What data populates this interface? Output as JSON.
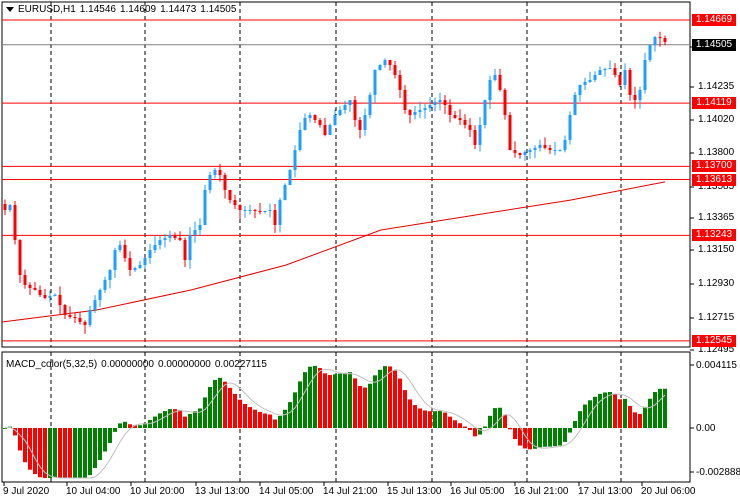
{
  "header": {
    "symbol": "EURUSD,H1",
    "open": "1.14546",
    "high": "1.14609",
    "low": "1.14473",
    "close": "1.14505"
  },
  "macd_header": {
    "label": "MACD_color(5,32,5)",
    "v1": "0.00000000",
    "v2": "0.00000000",
    "v3": "0.00227115"
  },
  "colors": {
    "bull": "#1E9FFF",
    "bear": "#FF0000",
    "macd_up": "#008000",
    "macd_down": "#FF0000",
    "level": "#FF0000",
    "ma": "#E00000",
    "signal": "#C0C0C0"
  },
  "price_axis": [
    "1.14455",
    "1.14235",
    "1.14020",
    "1.13800",
    "1.13585",
    "1.13365",
    "1.13150",
    "1.12930",
    "1.12715",
    "1.12495"
  ],
  "price_levels": [
    {
      "value": 1.14669,
      "label": "1.14669"
    },
    {
      "value": 1.14119,
      "label": "1.14119"
    },
    {
      "value": 1.137,
      "label": "1.13700"
    },
    {
      "value": 1.13613,
      "label": "1.13613"
    },
    {
      "value": 1.13243,
      "label": "1.13243"
    },
    {
      "value": 1.12545,
      "label": "1.12545"
    }
  ],
  "current_price": {
    "value": 1.14505,
    "label": "1.14505"
  },
  "macd_axis": {
    "top": "0.004115",
    "zero": "0.00",
    "bottom": "-0.002888"
  },
  "time_axis": [
    "9 Jul 2020",
    "10 Jul 04:00",
    "10 Jul 20:00",
    "13 Jul 13:00",
    "14 Jul 05:00",
    "14 Jul 21:00",
    "15 Jul 13:00",
    "16 Jul 05:00",
    "16 Jul 21:00",
    "17 Jul 13:00",
    "20 Jul 06:00"
  ],
  "chart_data": {
    "type": "candlestick",
    "title": "EURUSD,H1",
    "ylim": [
      1.12495,
      1.14669
    ],
    "closes": [
      1.13411,
      1.13444,
      1.13213,
      1.12981,
      1.12915,
      1.12895,
      1.12882,
      1.12849,
      1.12829,
      1.12842,
      1.12849,
      1.12782,
      1.12716,
      1.12703,
      1.12696,
      1.1267,
      1.1265,
      1.12749,
      1.12815,
      1.12882,
      1.12948,
      1.13014,
      1.13146,
      1.1318,
      1.13093,
      1.13014,
      1.13027,
      1.13047,
      1.13093,
      1.13146,
      1.1318,
      1.13213,
      1.13226,
      1.13246,
      1.13226,
      1.13213,
      1.1308,
      1.13246,
      1.13279,
      1.13312,
      1.13544,
      1.13643,
      1.13676,
      1.13643,
      1.13544,
      1.13477,
      1.13444,
      1.13411,
      1.13411,
      1.13411,
      1.13405,
      1.13398,
      1.13405,
      1.13411,
      1.13312,
      1.13477,
      1.13577,
      1.13676,
      1.13808,
      1.13941,
      1.1402,
      1.1404,
      1.14007,
      1.13974,
      1.13908,
      1.13974,
      1.1404,
      1.14073,
      1.14106,
      1.14139,
      1.14007,
      1.13941,
      1.1404,
      1.14173,
      1.14338,
      1.14371,
      1.14404,
      1.14371,
      1.14305,
      1.14206,
      1.14073,
      1.1404,
      1.1406,
      1.14073,
      1.14086,
      1.14106,
      1.14126,
      1.14139,
      1.14106,
      1.1404,
      1.1402,
      1.14007,
      1.13974,
      1.13941,
      1.13842,
      1.13974,
      1.14139,
      1.14272,
      1.14305,
      1.14206,
      1.1404,
      1.13808,
      1.13789,
      1.13775,
      1.13795,
      1.13808,
      1.13822,
      1.13842,
      1.13822,
      1.13808,
      1.13808,
      1.13808,
      1.13875,
      1.1404,
      1.14173,
      1.14239,
      1.14259,
      1.14272,
      1.14305,
      1.14338,
      1.14345,
      1.14351,
      1.14305,
      1.14239,
      1.14338,
      1.14173,
      1.14139,
      1.14206,
      1.14404,
      1.14503,
      1.14556,
      1.1455,
      1.14523
    ],
    "moving_average": [
      1.1267,
      1.12749,
      1.12882,
      1.13047,
      1.13279,
      1.13378,
      1.13477,
      1.13597
    ],
    "macd": {
      "params": "5,32,5",
      "ylim": [
        -0.002888,
        0.004115
      ]
    }
  }
}
